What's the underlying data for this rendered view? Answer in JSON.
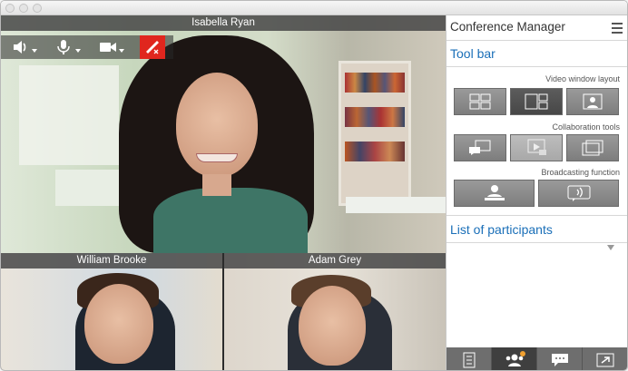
{
  "main_video": {
    "participant_name": "Isabella Ryan"
  },
  "thumbnails": [
    {
      "participant_name": "William Brooke"
    },
    {
      "participant_name": "Adam Grey"
    }
  ],
  "call_controls": [
    "speaker-icon",
    "microphone-icon",
    "camera-icon",
    "hang-up-icon"
  ],
  "panel": {
    "title": "Conference Manager",
    "toolbar_section": "Tool bar",
    "video_layout_label": "Video window layout",
    "collaboration_label": "Collaboration tools",
    "broadcasting_label": "Broadcasting function",
    "participants_section": "List of participants"
  },
  "bottom_tabs": [
    "list-icon",
    "participants-icon",
    "chat-icon",
    "exit-icon"
  ],
  "colors": {
    "accent": "#1a6fb8",
    "hangup": "#e0261e",
    "badge": "#f0a030"
  }
}
